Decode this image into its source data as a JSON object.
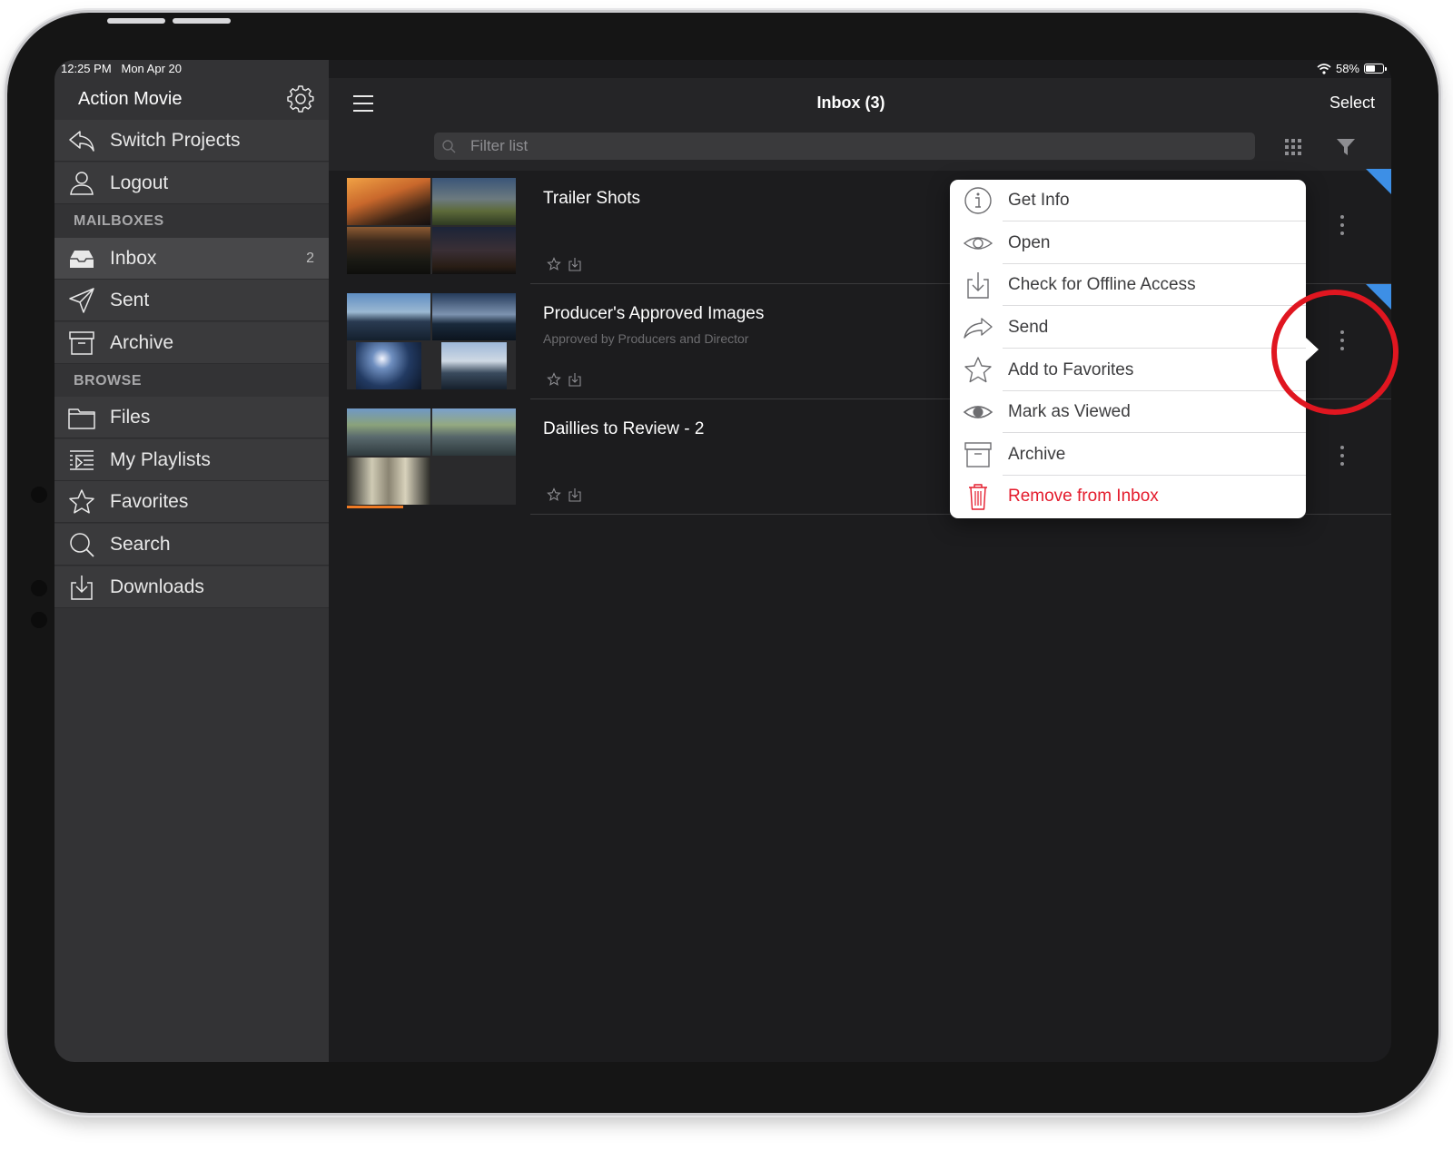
{
  "status_bar": {
    "time": "12:25 PM",
    "date": "Mon Apr 20",
    "battery": "58%"
  },
  "sidebar": {
    "title": "Action Movie",
    "top_items": [
      {
        "label": "Switch Projects",
        "icon": "back-arrow-icon"
      },
      {
        "label": "Logout",
        "icon": "user-icon"
      }
    ],
    "mailboxes_header": "MAILBOXES",
    "mailboxes": [
      {
        "label": "Inbox",
        "count": "2",
        "icon": "inbox-icon"
      },
      {
        "label": "Sent",
        "icon": "paper-plane-icon"
      },
      {
        "label": "Archive",
        "icon": "archive-box-icon"
      }
    ],
    "browse_header": "BROWSE",
    "browse": [
      {
        "label": "Files",
        "icon": "folder-icon"
      },
      {
        "label": "My Playlists",
        "icon": "playlist-icon"
      },
      {
        "label": "Favorites",
        "icon": "star-icon"
      },
      {
        "label": "Search",
        "icon": "search-icon"
      },
      {
        "label": "Downloads",
        "icon": "download-icon"
      }
    ]
  },
  "nav": {
    "title": "Inbox (3)",
    "select_label": "Select"
  },
  "filter": {
    "placeholder": "Filter list"
  },
  "items": [
    {
      "title": "Trailer Shots",
      "subtitle": ""
    },
    {
      "title": "Producer's Approved Images",
      "subtitle": "Approved by Producers and Director"
    },
    {
      "title": "Daillies to Review - 2",
      "subtitle": ""
    }
  ],
  "context_menu": {
    "items": [
      {
        "label": "Get Info",
        "icon": "info-icon"
      },
      {
        "label": "Open",
        "icon": "eye-icon"
      },
      {
        "label": "Check for Offline Access",
        "icon": "download-tray-icon"
      },
      {
        "label": "Send",
        "icon": "share-arrow-icon"
      },
      {
        "label": "Add to Favorites",
        "icon": "star-icon"
      },
      {
        "label": "Mark as Viewed",
        "icon": "eye-filled-icon"
      },
      {
        "label": "Archive",
        "icon": "archive-box-icon"
      },
      {
        "label": "Remove from Inbox",
        "icon": "trash-icon",
        "danger": true
      }
    ]
  },
  "colors": {
    "accent_blue": "#3d8fe6",
    "danger_red": "#e41b2c",
    "highlight_circle": "#e01620",
    "progress_orange": "#f07b24"
  }
}
